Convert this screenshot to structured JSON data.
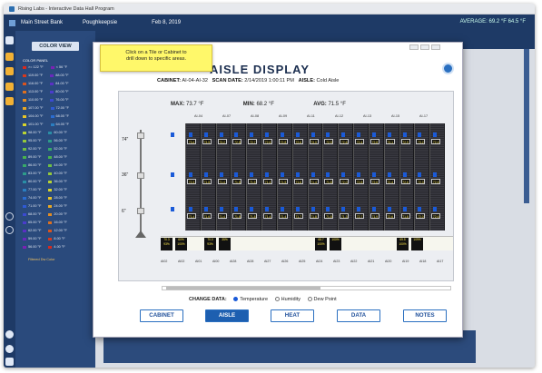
{
  "app": {
    "window_title": "Rising Labs - Interactive Data Hall Program",
    "menu": [
      "Main Street Bank",
      "Poughkeepsie",
      "Feb 8, 2019"
    ],
    "avg_readout": "AVERAGE: 69.2 °F 64.5 °F"
  },
  "color_panel": {
    "button": "COLOR VIEW",
    "heading": "COLOR PANEL",
    "legend_left": [
      ">= 122 °F",
      "119.00 °F",
      "116.00 °F",
      "113.00 °F",
      "110.00 °F",
      "107.00 °F",
      "104.00 °F",
      "101.00 °F",
      "98.00 °F",
      "95.00 °F",
      "92.00 °F",
      "89.00 °F",
      "86.00 °F",
      "83.00 °F",
      "80.00 °F",
      "77.00 °F",
      "74.00 °F",
      "71.00 °F",
      "68.00 °F",
      "65.00 °F",
      "62.00 °F",
      "59.00 °F",
      "56.00 °F"
    ],
    "legend_right": [
      "< 56 °F",
      "88.00 °F",
      "84.00 °F",
      "80.00 °F",
      "76.00 °F",
      "72.00 °F",
      "68.00 °F",
      "64.00 °F",
      "60.00 °F",
      "56.00 °F",
      "52.00 °F",
      "48.00 °F",
      "44.00 °F",
      "40.00 °F",
      "36.00 °F",
      "32.00 °F",
      "28.00 °F",
      "24.00 °F",
      "20.00 °F",
      "16.00 °F",
      "12.00 °F",
      "8.00 °F",
      "4.00 °F"
    ],
    "colors": [
      "#d62a1e",
      "#d63a1e",
      "#d9541f",
      "#dc7020",
      "#e28c22",
      "#e8a824",
      "#e8c428",
      "#d8d42c",
      "#b8d234",
      "#94c83c",
      "#6ebe44",
      "#4ab44c",
      "#38a86a",
      "#2e9c8a",
      "#2a8ea6",
      "#2a7ec0",
      "#2a6cd0",
      "#2f5ad4",
      "#3a4ad0",
      "#4a3ccc",
      "#5a30c4",
      "#6a28bc",
      "#7a22b2"
    ],
    "filter_label": "Filtered Dw Color"
  },
  "dialog": {
    "title": "AISLE DISPLAY",
    "cabinet_label": "CABINET:",
    "cabinet_value": "AI-04-AI-32",
    "scan_label": "SCAN DATE:",
    "scan_value": "2/14/2019 1:00:11 PM",
    "aisle_label": "AISLE:",
    "aisle_value": "Cold Aisle",
    "tooltip_line1": "Click on a Tile or Cabinet to",
    "tooltip_line2": "drill down to specific areas.",
    "max_label": "MAX:",
    "max_value": "73.7 °F",
    "min_label": "MIN:",
    "min_value": "68.2 °F",
    "avg_label": "AVG:",
    "avg_value": "71.5 °F",
    "heights": [
      "74\"",
      "36\"",
      "6\""
    ],
    "rack_labels_top": [
      "AI-04",
      "AI-07",
      "AI-08",
      "AI-09",
      "AI-11",
      "AI-12",
      "AI-13",
      "AI-15",
      "AI-17"
    ],
    "row_values": {
      "top": [
        "73.4",
        "73.5",
        "73.2",
        "72.8",
        "72.7",
        "72.6",
        "72.8",
        "72.6",
        "73.0",
        "72.9",
        "72.6",
        "72.4",
        "72.8",
        "73.1",
        "72.9",
        "73.2",
        "72.4"
      ],
      "mid": [
        "72.3",
        "71.8",
        "71.4",
        "71.8",
        "71.5",
        "71.4",
        "71.5",
        "71.6",
        "71.4",
        "71.8",
        "72.0",
        "72.8",
        "72.6",
        "72.4",
        "72.6",
        "72.3",
        "72.6"
      ],
      "low": [
        "71.4",
        "71.6",
        "71.4",
        "71.8",
        "71.8",
        "71.4",
        "71.4",
        "71.7",
        "71.8",
        "71.5",
        "71.3",
        "72.7",
        "71.9",
        "72.6",
        "71.8",
        "72.0",
        "72.6"
      ]
    },
    "bottom_cells": [
      {
        "t": "70.3",
        "b": "93%"
      },
      {
        "t": "60%",
        "b": "100%"
      },
      {
        "t": "70.0",
        "b": "93%"
      },
      {
        "t": "",
        "b": "35%"
      },
      {
        "t": "68.7",
        "b": "100%"
      },
      {
        "t": "",
        "b": "100%"
      },
      {
        "t": "69.5",
        "b": "100%"
      },
      {
        "t": "",
        "b": "109%"
      }
    ],
    "bottom_labels": [
      "AI02",
      "AI02",
      "AI01",
      "AI00",
      "AI28",
      "AI28",
      "AI27",
      "AI26",
      "AI25",
      "AI24",
      "AI23",
      "AI22",
      "AI21",
      "AI20",
      "AI19",
      "AI18",
      "AI17"
    ],
    "change_data_label": "CHANGE DATA:",
    "radio_options": [
      "Temperature",
      "Humidity",
      "Dew Point"
    ],
    "buttons": [
      "CABINET",
      "AISLE",
      "HEAT",
      "DATA",
      "NOTES"
    ]
  }
}
